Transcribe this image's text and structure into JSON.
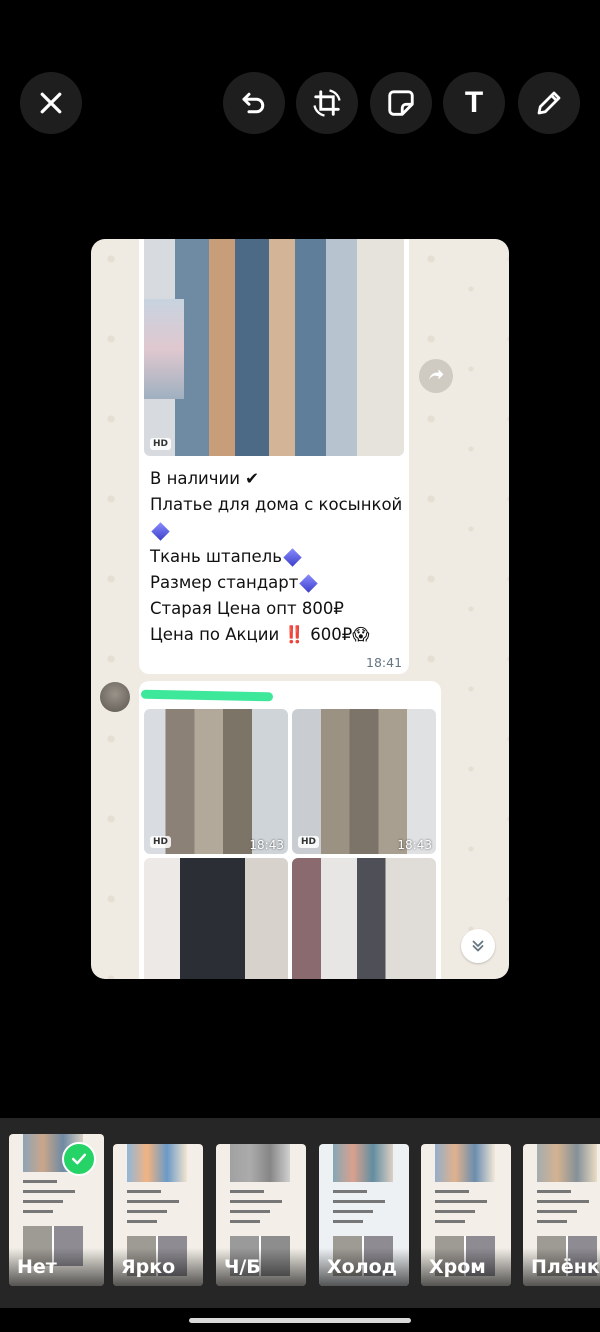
{
  "toolbar": {
    "close": "close-icon",
    "undo": "undo-icon",
    "crop": "crop-rotate-icon",
    "sticker": "sticker-icon",
    "text": "T",
    "draw": "pencil-icon"
  },
  "message1": {
    "lines": [
      "В наличии ✔",
      "Платье для дома с косынкой",
      "",
      "Ткань штапель",
      "Размер стандарт",
      "Старая Цена опт 800₽",
      "Цена по Акции",
      "600₽"
    ],
    "exclaim": "‼️",
    "emoji": "😱",
    "time": "18:41",
    "hd": "HD"
  },
  "message2": {
    "time1": "18:43",
    "time2": "18:43",
    "hd": "HD"
  },
  "filters": [
    {
      "label": "Нет",
      "selected": true
    },
    {
      "label": "Ярко"
    },
    {
      "label": "Ч/Б"
    },
    {
      "label": "Холод"
    },
    {
      "label": "Хром"
    },
    {
      "label": "Плёнка"
    }
  ],
  "colors": {
    "accent": "#25d366",
    "background": "#000000",
    "bar": "#262626"
  }
}
